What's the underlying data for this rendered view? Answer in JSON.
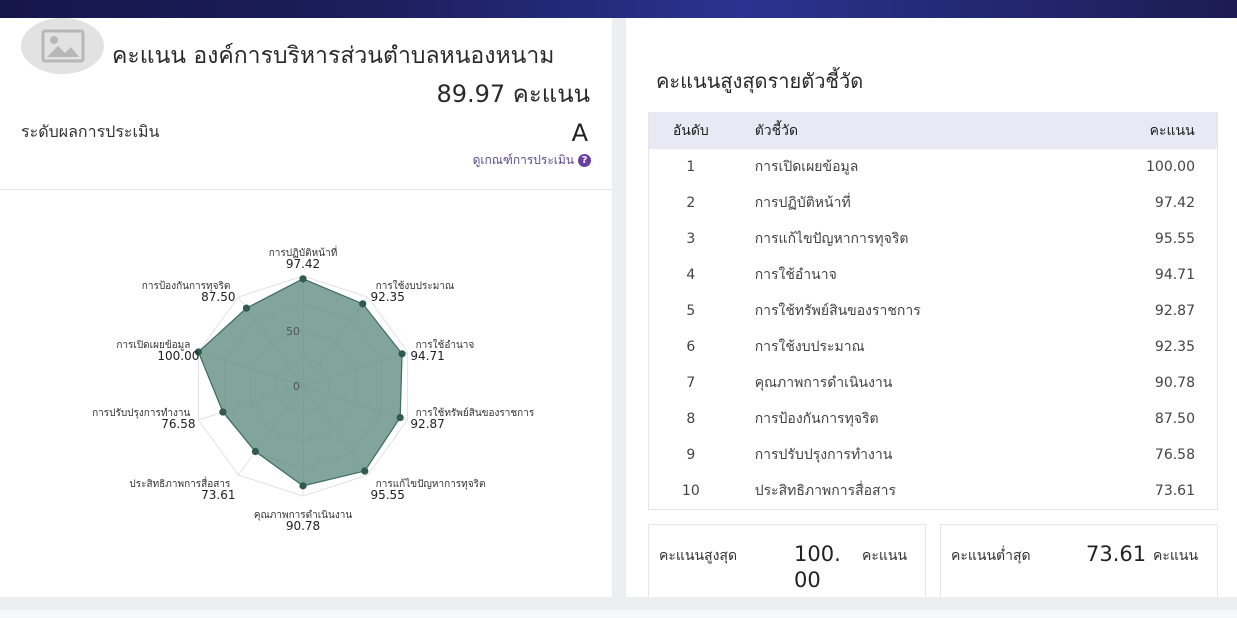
{
  "header": {
    "title": "คะแนน องค์การบริหารส่วนตำบลหนองหนาม",
    "total_score": "89.97 คะแนน"
  },
  "level": {
    "label": "ระดับผลการประเมิน",
    "value": "A",
    "criteria_link": "ดูเกณฑ์การประเมิน",
    "help_icon": "?"
  },
  "colors": {
    "radar_fill": "#5e8a7f",
    "radar_point": "#2f5a50",
    "header_bg": "#e9e8f5",
    "link": "#5d4a8e"
  },
  "chart_data": {
    "type": "radar",
    "range": [
      0,
      100
    ],
    "tick_labels": [
      "0",
      "50"
    ],
    "axes": [
      {
        "label": "การปฏิบัติหน้าที่",
        "value": 97.42,
        "value_text": "97.42"
      },
      {
        "label": "การใช้งบประมาณ",
        "value": 92.35,
        "value_text": "92.35"
      },
      {
        "label": "การใช้อำนาจ",
        "value": 94.71,
        "value_text": "94.71"
      },
      {
        "label": "การใช้ทรัพย์สินของราชการ",
        "value": 92.87,
        "value_text": "92.87"
      },
      {
        "label": "การแก้ไขปัญหาการทุจริต",
        "value": 95.55,
        "value_text": "95.55"
      },
      {
        "label": "คุณภาพการดำเนินงาน",
        "value": 90.78,
        "value_text": "90.78"
      },
      {
        "label": "ประสิทธิภาพการสื่อสาร",
        "value": 73.61,
        "value_text": "73.61"
      },
      {
        "label": "การปรับปรุงการทำงาน",
        "value": 76.58,
        "value_text": "76.58"
      },
      {
        "label": "การเปิดเผยข้อมูล",
        "value": 100.0,
        "value_text": "100.00"
      },
      {
        "label": "การป้องกันการทุจริต",
        "value": 87.5,
        "value_text": "87.50"
      }
    ]
  },
  "ranking": {
    "title": "คะแนนสูงสุดรายตัวชี้วัด",
    "columns": {
      "rank": "อันดับ",
      "indicator": "ตัวชี้วัด",
      "score": "คะแนน"
    },
    "rows": [
      {
        "rank": "1",
        "name": "การเปิดเผยข้อมูล",
        "score": "100.00"
      },
      {
        "rank": "2",
        "name": "การปฏิบัติหน้าที่",
        "score": "97.42"
      },
      {
        "rank": "3",
        "name": "การแก้ไขปัญหาการทุจริต",
        "score": "95.55"
      },
      {
        "rank": "4",
        "name": "การใช้อำนาจ",
        "score": "94.71"
      },
      {
        "rank": "5",
        "name": "การใช้ทรัพย์สินของราชการ",
        "score": "92.87"
      },
      {
        "rank": "6",
        "name": "การใช้งบประมาณ",
        "score": "92.35"
      },
      {
        "rank": "7",
        "name": "คุณภาพการดำเนินงาน",
        "score": "90.78"
      },
      {
        "rank": "8",
        "name": "การป้องกันการทุจริต",
        "score": "87.50"
      },
      {
        "rank": "9",
        "name": "การปรับปรุงการทำงาน",
        "score": "76.58"
      },
      {
        "rank": "10",
        "name": "ประสิทธิภาพการสื่อสาร",
        "score": "73.61"
      }
    ]
  },
  "summary": {
    "max_label": "คะแนนสูงสุด",
    "max_value_line1": "100.",
    "max_value_line2": "00",
    "min_label": "คะแนนต่ำสุด",
    "min_value": "73.61",
    "unit": "คะแนน"
  }
}
